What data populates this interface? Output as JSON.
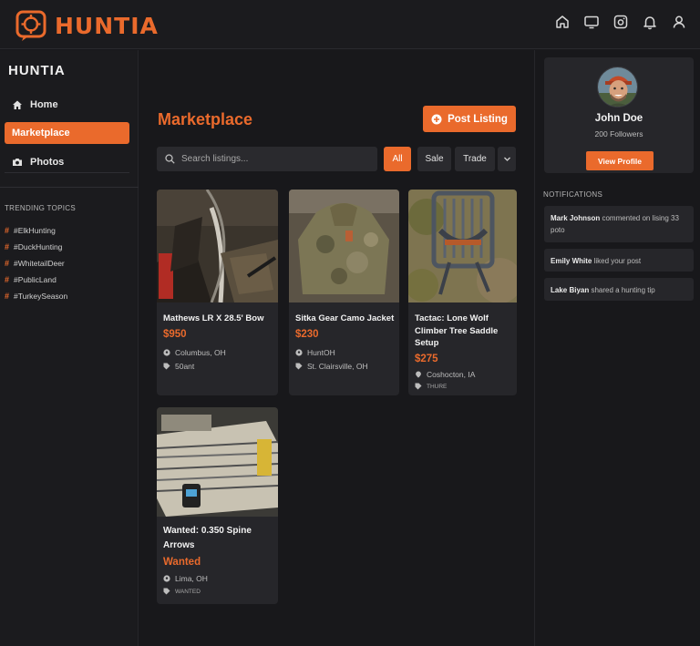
{
  "app": {
    "name": "HUNTIA"
  },
  "header": {
    "icons": [
      "home-icon",
      "tv-icon",
      "camera-icon",
      "bell-icon",
      "user-icon"
    ]
  },
  "sidebar": {
    "title": "HUNTIA",
    "items": [
      {
        "label": "Home",
        "icon": "home-icon",
        "active": false
      },
      {
        "label": "Marketplace",
        "icon": "store-icon",
        "active": true
      },
      {
        "label": "Photos",
        "icon": "camera-icon",
        "active": false
      }
    ],
    "trending_title": "TRENDING TOPICS",
    "trending": [
      "#ElkHunting",
      "#DuckHunting",
      "#WhitetailDeer",
      "#PublicLand",
      "#TurkeySeason"
    ]
  },
  "main": {
    "title": "Marketplace",
    "post_button": "Post Listing",
    "search_placeholder": "Search listings...",
    "filters": [
      "All",
      "Sale",
      "Trade"
    ],
    "active_filter": "All",
    "listings": [
      {
        "title": "Mathews LR X 28.5' Bow",
        "price": "$950",
        "location": "Columbus, OH",
        "tag": "50ant"
      },
      {
        "title": "Sitka Gear Camo Jacket",
        "price": "$230",
        "location": "HuntOH",
        "tag": "St. Clairsville, OH"
      },
      {
        "title_line1": "Tactac: Lone Wolf",
        "title_line2": "Climber Tree Saddle",
        "title_line3": "Setup",
        "price": "$275",
        "location": "Coshocton, IA",
        "tag": "THURE"
      },
      {
        "title_line1": "Wanted: 0.350 Spine",
        "title_line2": "Arrows",
        "price": "Wanted",
        "location": "Lima, OH",
        "tag": "WANTED"
      }
    ]
  },
  "profile": {
    "name": "John Doe",
    "followers": "200 Followers",
    "view_button": "View Profile"
  },
  "notifications": {
    "title": "NOTIFICATIONS",
    "items": [
      {
        "user": "Mark Johnson",
        "text": " commented on lising 33 poto"
      },
      {
        "user": "Emily White",
        "text": " liked your post"
      },
      {
        "user": "Lake Biyan",
        "text": " shared a hunting tip"
      }
    ]
  },
  "colors": {
    "accent": "#ea6a2c",
    "background": "#18181b",
    "card": "#26262a"
  }
}
